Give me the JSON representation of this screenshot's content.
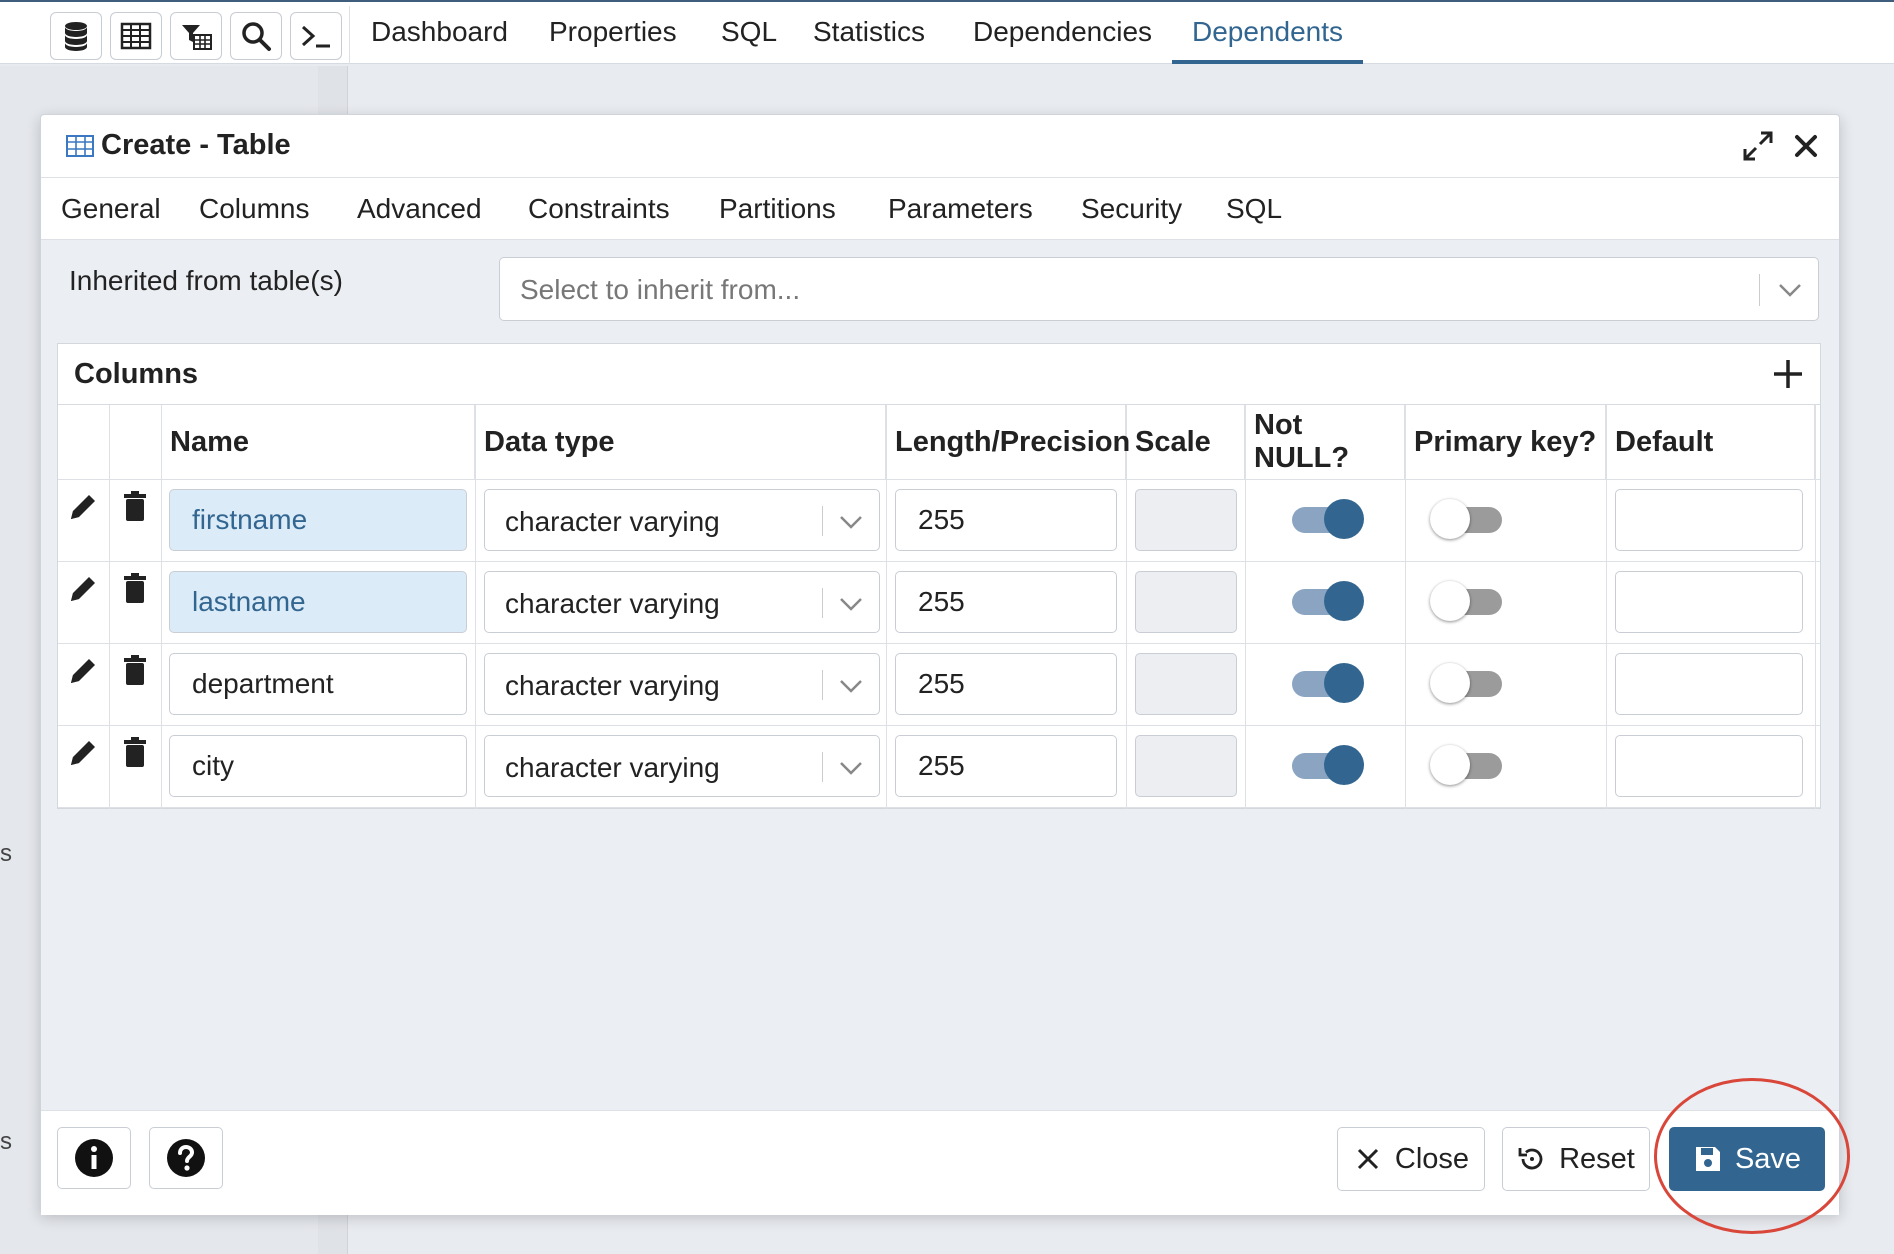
{
  "toolbar": {
    "icons": [
      "database-icon",
      "table-grid-icon",
      "table-filter-icon",
      "search-icon",
      "terminal-icon"
    ],
    "tabs": [
      "Dashboard",
      "Properties",
      "SQL",
      "Statistics",
      "Dependencies",
      "Dependents"
    ],
    "active_tab": "Dependents"
  },
  "left_panel": {
    "fragments": [
      "s",
      "s"
    ]
  },
  "dialog": {
    "title": "Create - Table",
    "tabs": [
      "General",
      "Columns",
      "Advanced",
      "Constraints",
      "Partitions",
      "Parameters",
      "Security",
      "SQL"
    ],
    "active_tab": "Columns",
    "inherit": {
      "label": "Inherited from table(s)",
      "placeholder": "Select to inherit from..."
    },
    "columns_panel": {
      "title": "Columns",
      "headers": [
        "Name",
        "Data type",
        "Length/Precision",
        "Scale",
        "Not NULL?",
        "Primary key?",
        "Default"
      ],
      "rows": [
        {
          "name": "firstname",
          "data_type": "character varying",
          "length": "255",
          "scale": "",
          "not_null": true,
          "primary_key": false,
          "default": "",
          "highlighted": true
        },
        {
          "name": "lastname",
          "data_type": "character varying",
          "length": "255",
          "scale": "",
          "not_null": true,
          "primary_key": false,
          "default": "",
          "highlighted": true
        },
        {
          "name": "department",
          "data_type": "character varying",
          "length": "255",
          "scale": "",
          "not_null": true,
          "primary_key": false,
          "default": "",
          "highlighted": false
        },
        {
          "name": "city",
          "data_type": "character varying",
          "length": "255",
          "scale": "",
          "not_null": true,
          "primary_key": false,
          "default": "",
          "highlighted": false
        }
      ]
    },
    "footer": {
      "close_label": "Close",
      "reset_label": "Reset",
      "save_label": "Save"
    }
  },
  "colors": {
    "accent": "#326690",
    "highlight_bg": "#dcebf8",
    "annotation": "#d9463a"
  }
}
